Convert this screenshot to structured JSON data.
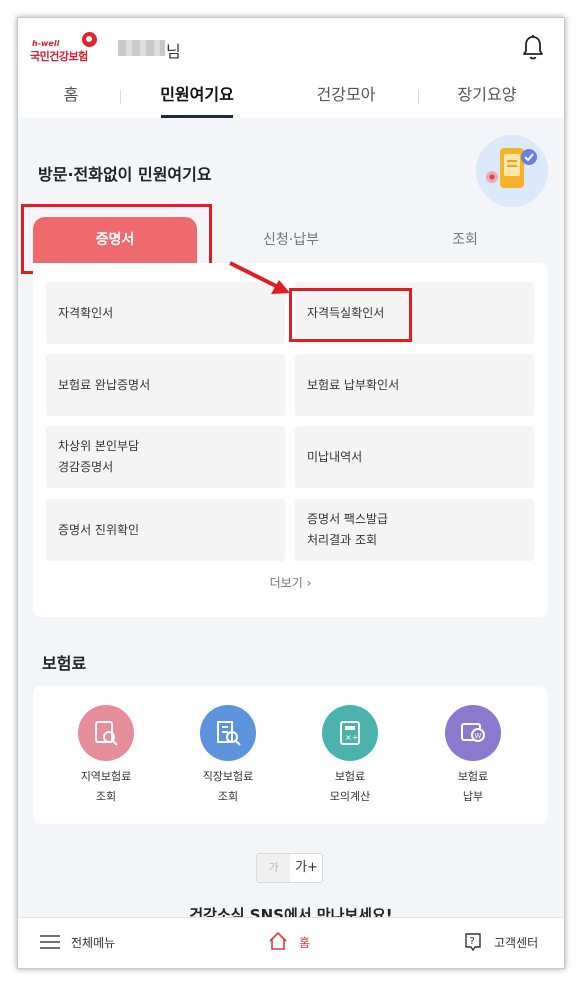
{
  "header": {
    "logo_en": "h-well",
    "logo_ko": "국민건강보험",
    "user_suffix": "님"
  },
  "nav": {
    "tabs": [
      "홈",
      "민원여기요",
      "건강모아",
      "장기요양"
    ],
    "active_index": 1
  },
  "civil": {
    "title": "방문·전화없이 민원여기요",
    "segments": [
      "증명서",
      "신청·납부",
      "조회"
    ],
    "items": [
      "자격확인서",
      "자격득실확인서",
      "보험료 완납증명서",
      "보험료 납부확인서",
      "차상위 본인부담\n경감증명서",
      "미납내역서",
      "증명서 진위확인",
      "증명서 팩스발급\n처리결과 조회"
    ],
    "more": "더보기"
  },
  "insurance": {
    "title": "보험료",
    "items": [
      {
        "label_line1": "지역보험료",
        "label_line2": "조회",
        "color": "#e78c9a",
        "icon": "search-document-icon"
      },
      {
        "label_line1": "직장보험료",
        "label_line2": "조회",
        "color": "#5b94dc",
        "icon": "building-search-icon"
      },
      {
        "label_line1": "보험료",
        "label_line2": "모의계산",
        "color": "#4bb3ae",
        "icon": "calculator-icon"
      },
      {
        "label_line1": "보험료",
        "label_line2": "납부",
        "color": "#8a79cf",
        "icon": "payment-card-icon"
      }
    ]
  },
  "font_size": {
    "small": "가",
    "large": "가+"
  },
  "sns_heading": "건강소식 SNS에서 만나보세요!",
  "bottom_bar": {
    "menu": "전체메뉴",
    "home": "홈",
    "support": "고객센터"
  },
  "colors": {
    "accent": "#ee6a6f",
    "highlight_box": "#e21c23",
    "nav_underline": "#1b2b44"
  }
}
